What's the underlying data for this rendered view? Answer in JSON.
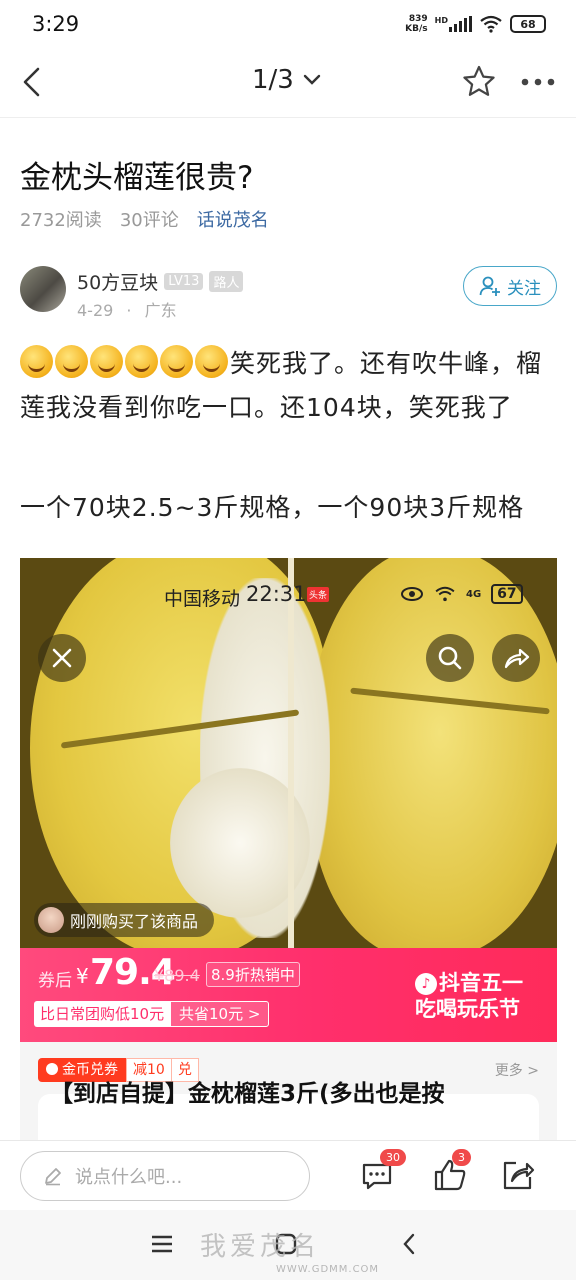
{
  "status_bar": {
    "time": "3:29",
    "net_speed_value": "839",
    "net_speed_unit": "KB/s",
    "hd": "HD",
    "battery": "68"
  },
  "nav": {
    "page_indicator": "1/3"
  },
  "article": {
    "title": "金枕头榴莲很贵?",
    "reads": "2732阅读",
    "comments": "30评论",
    "topic": "话说茂名",
    "author": {
      "name": "50方豆块",
      "level": "LV13",
      "tag": "路人",
      "date": "4-29",
      "location": "广东",
      "follow_label": "关注"
    },
    "paragraph1": "笑死我了。还有吹牛峰，榴莲我没看到你吃一口。还104块，笑死我了",
    "paragraph2": "一个70块2.5~3斤规格，一个90块3斤规格"
  },
  "embedded": {
    "carrier": "中国移动",
    "time": "22:31",
    "toutiao": "头条",
    "net": "4G",
    "battery": "67",
    "bought_text": "刚刚购买了该商品",
    "after_coupon": "券后",
    "yen": "¥",
    "price": "79.4",
    "original_price": "¥89.4",
    "discount": "8.9折热销中",
    "daily_compare": "比日常团购低10元",
    "save": "共省10元 >",
    "festival_line1": "抖音五一",
    "festival_line2": "吃喝玩乐节",
    "coupon_tag": "金币兑券",
    "coupon_minus": "减10",
    "coupon_exchange": "兑",
    "more": "更多 >",
    "product_title": "【到店自提】金枕榴莲3斤(多出也是按"
  },
  "actionbar": {
    "placeholder": "说点什么吧...",
    "comment_count": "30",
    "like_count": "3"
  },
  "watermark": {
    "text": "我爱茂名",
    "sub": "WWW.GDMM.COM"
  },
  "colors": {
    "accent": "#2b90bd",
    "topic": "#3d6aa3",
    "promo": "#ff2f6c",
    "badge_red": "#f04a4a"
  }
}
